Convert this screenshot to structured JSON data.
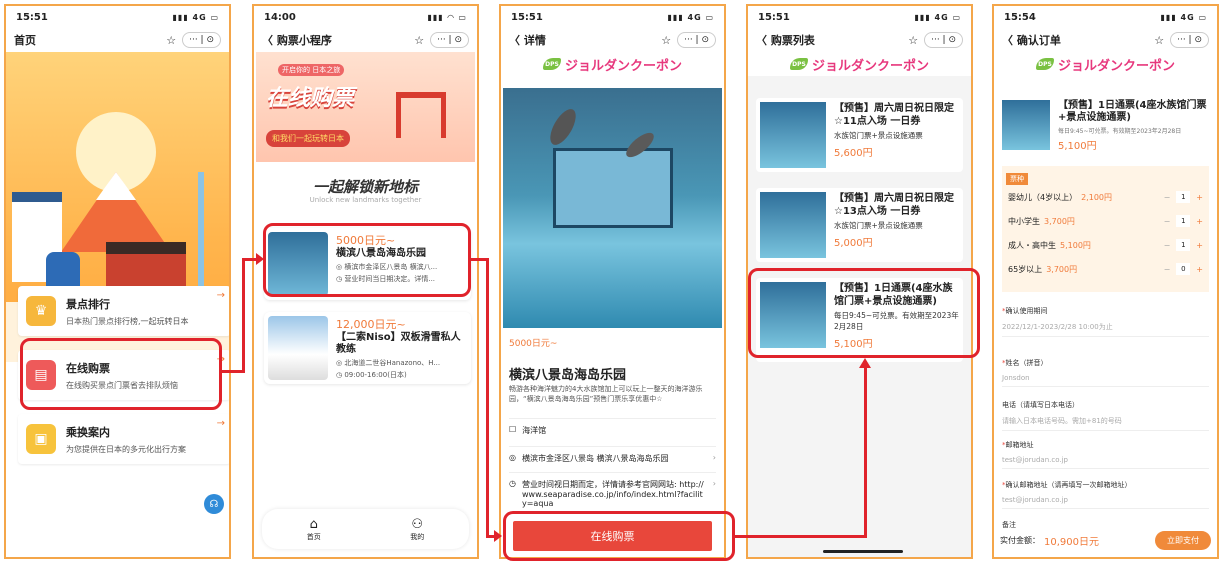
{
  "p1": {
    "time": "15:51",
    "signal": "4G",
    "title": "首页",
    "cards": [
      {
        "title": "景点排行",
        "sub": "日本热门景点排行榜,一起玩转日本"
      },
      {
        "title": "在线购票",
        "sub": "在线购买景点门票省去排队烦恼"
      },
      {
        "title": "乘换案内",
        "sub": "为您提供在日本的多元化出行方案"
      }
    ]
  },
  "p2": {
    "time": "14:00",
    "title": "购票小程序",
    "banner_tag0": "开启你的 日本之旅",
    "banner_big": "在线购票",
    "banner_tag": "和我们一起玩转日本",
    "headline": "一起解锁新地标",
    "headline_sub": "Unlock new landmarks together",
    "tickets": [
      {
        "price": "5000日元~",
        "name": "横滨八景岛海岛乐园",
        "addr": "横滨市金泽区八景岛 横滨八...",
        "hours": "营业时间当日期决定。详情..."
      },
      {
        "price": "12,000日元~",
        "name": "【二索Niso】双板滑雪私人教练",
        "addr": "北海道二世谷Hanazono、H...",
        "hours": "09:00-16:00(日本)"
      }
    ],
    "tabs": {
      "home": "首页",
      "mine": "我的"
    }
  },
  "p3": {
    "time": "15:51",
    "title": "详情",
    "logo": "ジョルダンクーポン",
    "price": "5000日元~",
    "name": "横滨八景岛海岛乐园",
    "desc": "畅游各种海洋魅力的4大水族馆加上可以玩上一整天的海洋游乐园，“横滨八景岛海岛乐园”预售门票乐享优惠中☆",
    "tag": "海洋馆",
    "addr": "横滨市金泽区八景岛 横滨八景岛海岛乐园",
    "hours": "营业时间视日期而定，详情请参考官网网站: http://www.seaparadise.co.jp/info/index.html?facility=aqua",
    "button": "在线购票"
  },
  "p4": {
    "time": "15:51",
    "title": "购票列表",
    "items": [
      {
        "name": "【预售】周六周日祝日限定☆11点入场 一日券",
        "sub": "水族馆门票+景点设施通票",
        "price": "5,600円"
      },
      {
        "name": "【预售】周六周日祝日限定☆13点入场 一日券",
        "sub": "水族馆门票+景点设施通票",
        "price": "5,000円"
      },
      {
        "name": "【预售】1日通票(4座水族馆门票+景点设施通票)",
        "sub": "每日9:45~可兑票。有效期至2023年2月28日",
        "price": "5,100円"
      }
    ]
  },
  "p5": {
    "time": "15:54",
    "title": "确认订单",
    "item_name": "【预售】1日通票(4座水族馆门票+景点设施通票)",
    "item_sub": "每日9:45~可兑票。有效期至2023年2月28日",
    "item_price": "5,100円",
    "ticket_label": "票种",
    "tickets": [
      {
        "label": "婴幼儿（4岁以上）",
        "price": "2,100円",
        "qty": "1"
      },
      {
        "label": "中小学生",
        "price": "3,700円",
        "qty": "1"
      },
      {
        "label": "成人・高中生",
        "price": "5,100円",
        "qty": "1"
      },
      {
        "label": "65岁以上",
        "price": "3,700円",
        "qty": "0"
      }
    ],
    "fields": [
      {
        "label": "确认使用期间",
        "value": "2022/12/1-2023/2/28 10:00为止",
        "req": "*"
      },
      {
        "label": "姓名（拼音）",
        "value": "Jonsdon",
        "req": "*"
      },
      {
        "label": "电话（请填写日本电话）",
        "value": "请输入日本电话号码。需加+81的号码",
        "req": ""
      },
      {
        "label": "邮箱地址",
        "value": "test@jorudan.co.jp",
        "req": "*"
      },
      {
        "label": "确认邮箱地址（请再填写一次邮箱地址）",
        "value": "test@jorudan.co.jp",
        "req": "*"
      },
      {
        "label": "备注",
        "value": "",
        "req": ""
      }
    ],
    "total_label": "实付金额：",
    "total": "10,900日元",
    "pay": "立即支付"
  },
  "colors": {
    "accent": "#f07a3a",
    "highlight": "#e0232b",
    "buy": "#e8473b",
    "frame": "#f4a64a"
  }
}
